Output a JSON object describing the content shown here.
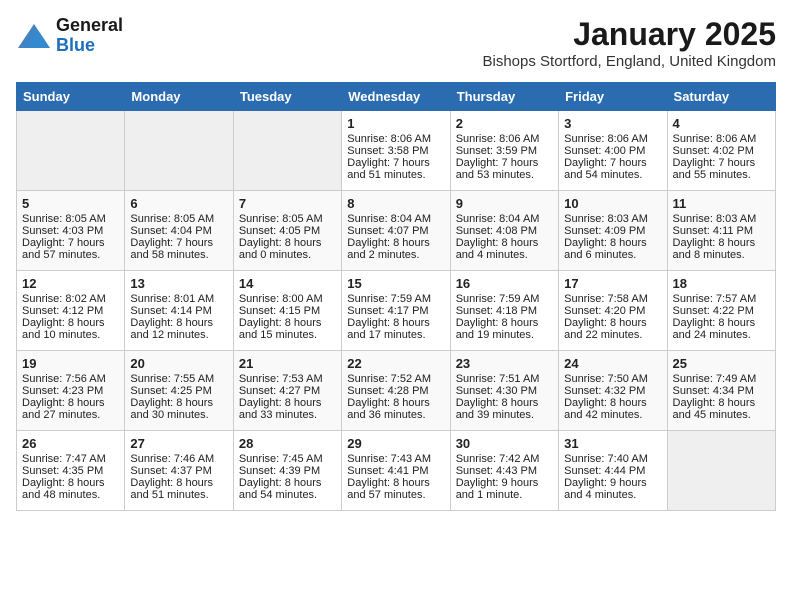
{
  "header": {
    "logo_line1": "General",
    "logo_line2": "Blue",
    "month": "January 2025",
    "location": "Bishops Stortford, England, United Kingdom"
  },
  "weekdays": [
    "Sunday",
    "Monday",
    "Tuesday",
    "Wednesday",
    "Thursday",
    "Friday",
    "Saturday"
  ],
  "weeks": [
    [
      {
        "day": "",
        "content": ""
      },
      {
        "day": "",
        "content": ""
      },
      {
        "day": "",
        "content": ""
      },
      {
        "day": "1",
        "content": "Sunrise: 8:06 AM\nSunset: 3:58 PM\nDaylight: 7 hours and 51 minutes."
      },
      {
        "day": "2",
        "content": "Sunrise: 8:06 AM\nSunset: 3:59 PM\nDaylight: 7 hours and 53 minutes."
      },
      {
        "day": "3",
        "content": "Sunrise: 8:06 AM\nSunset: 4:00 PM\nDaylight: 7 hours and 54 minutes."
      },
      {
        "day": "4",
        "content": "Sunrise: 8:06 AM\nSunset: 4:02 PM\nDaylight: 7 hours and 55 minutes."
      }
    ],
    [
      {
        "day": "5",
        "content": "Sunrise: 8:05 AM\nSunset: 4:03 PM\nDaylight: 7 hours and 57 minutes."
      },
      {
        "day": "6",
        "content": "Sunrise: 8:05 AM\nSunset: 4:04 PM\nDaylight: 7 hours and 58 minutes."
      },
      {
        "day": "7",
        "content": "Sunrise: 8:05 AM\nSunset: 4:05 PM\nDaylight: 8 hours and 0 minutes."
      },
      {
        "day": "8",
        "content": "Sunrise: 8:04 AM\nSunset: 4:07 PM\nDaylight: 8 hours and 2 minutes."
      },
      {
        "day": "9",
        "content": "Sunrise: 8:04 AM\nSunset: 4:08 PM\nDaylight: 8 hours and 4 minutes."
      },
      {
        "day": "10",
        "content": "Sunrise: 8:03 AM\nSunset: 4:09 PM\nDaylight: 8 hours and 6 minutes."
      },
      {
        "day": "11",
        "content": "Sunrise: 8:03 AM\nSunset: 4:11 PM\nDaylight: 8 hours and 8 minutes."
      }
    ],
    [
      {
        "day": "12",
        "content": "Sunrise: 8:02 AM\nSunset: 4:12 PM\nDaylight: 8 hours and 10 minutes."
      },
      {
        "day": "13",
        "content": "Sunrise: 8:01 AM\nSunset: 4:14 PM\nDaylight: 8 hours and 12 minutes."
      },
      {
        "day": "14",
        "content": "Sunrise: 8:00 AM\nSunset: 4:15 PM\nDaylight: 8 hours and 15 minutes."
      },
      {
        "day": "15",
        "content": "Sunrise: 7:59 AM\nSunset: 4:17 PM\nDaylight: 8 hours and 17 minutes."
      },
      {
        "day": "16",
        "content": "Sunrise: 7:59 AM\nSunset: 4:18 PM\nDaylight: 8 hours and 19 minutes."
      },
      {
        "day": "17",
        "content": "Sunrise: 7:58 AM\nSunset: 4:20 PM\nDaylight: 8 hours and 22 minutes."
      },
      {
        "day": "18",
        "content": "Sunrise: 7:57 AM\nSunset: 4:22 PM\nDaylight: 8 hours and 24 minutes."
      }
    ],
    [
      {
        "day": "19",
        "content": "Sunrise: 7:56 AM\nSunset: 4:23 PM\nDaylight: 8 hours and 27 minutes."
      },
      {
        "day": "20",
        "content": "Sunrise: 7:55 AM\nSunset: 4:25 PM\nDaylight: 8 hours and 30 minutes."
      },
      {
        "day": "21",
        "content": "Sunrise: 7:53 AM\nSunset: 4:27 PM\nDaylight: 8 hours and 33 minutes."
      },
      {
        "day": "22",
        "content": "Sunrise: 7:52 AM\nSunset: 4:28 PM\nDaylight: 8 hours and 36 minutes."
      },
      {
        "day": "23",
        "content": "Sunrise: 7:51 AM\nSunset: 4:30 PM\nDaylight: 8 hours and 39 minutes."
      },
      {
        "day": "24",
        "content": "Sunrise: 7:50 AM\nSunset: 4:32 PM\nDaylight: 8 hours and 42 minutes."
      },
      {
        "day": "25",
        "content": "Sunrise: 7:49 AM\nSunset: 4:34 PM\nDaylight: 8 hours and 45 minutes."
      }
    ],
    [
      {
        "day": "26",
        "content": "Sunrise: 7:47 AM\nSunset: 4:35 PM\nDaylight: 8 hours and 48 minutes."
      },
      {
        "day": "27",
        "content": "Sunrise: 7:46 AM\nSunset: 4:37 PM\nDaylight: 8 hours and 51 minutes."
      },
      {
        "day": "28",
        "content": "Sunrise: 7:45 AM\nSunset: 4:39 PM\nDaylight: 8 hours and 54 minutes."
      },
      {
        "day": "29",
        "content": "Sunrise: 7:43 AM\nSunset: 4:41 PM\nDaylight: 8 hours and 57 minutes."
      },
      {
        "day": "30",
        "content": "Sunrise: 7:42 AM\nSunset: 4:43 PM\nDaylight: 9 hours and 1 minute."
      },
      {
        "day": "31",
        "content": "Sunrise: 7:40 AM\nSunset: 4:44 PM\nDaylight: 9 hours and 4 minutes."
      },
      {
        "day": "",
        "content": ""
      }
    ]
  ]
}
